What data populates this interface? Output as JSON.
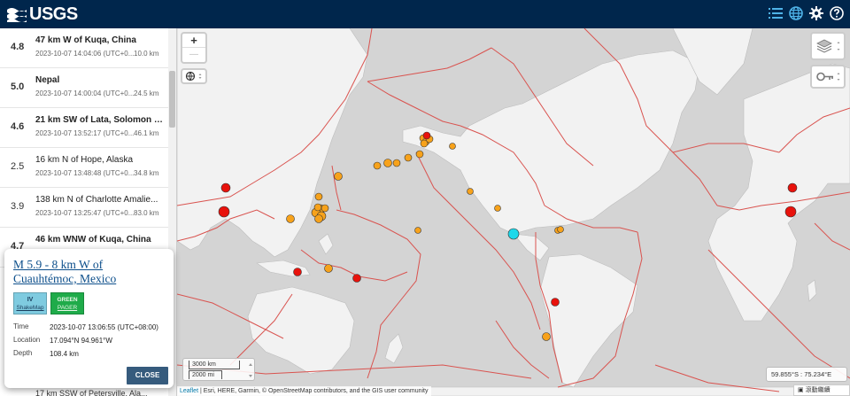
{
  "header": {
    "logo_text": "USGS",
    "icons": [
      "list-icon",
      "globe-icon",
      "gear-icon",
      "help-icon"
    ]
  },
  "list": {
    "items": [
      {
        "mag": "4.8",
        "place": "47 km W of Kuqa, China",
        "time": "2023-10-07 14:04:06 (UTC+0...",
        "depth": "10.0 km",
        "bold": true
      },
      {
        "mag": "5.0",
        "place": "Nepal",
        "time": "2023-10-07 14:00:04 (UTC+0...",
        "depth": "24.5 km",
        "bold": true
      },
      {
        "mag": "4.6",
        "place": "21 km SW of Lata, Solomon I...",
        "time": "2023-10-07 13:52:17 (UTC+0...",
        "depth": "46.1 km",
        "bold": true
      },
      {
        "mag": "2.5",
        "place": "16 km N of Hope, Alaska",
        "time": "2023-10-07 13:48:48 (UTC+0...",
        "depth": "34.8 km",
        "bold": false
      },
      {
        "mag": "3.9",
        "place": "138 km N of Charlotte Amalie...",
        "time": "2023-10-07 13:25:47 (UTC+0...",
        "depth": "83.0 km",
        "bold": false
      },
      {
        "mag": "4.7",
        "place": "46 km WNW of Kuqa, China",
        "time": "",
        "depth": "",
        "bold": true
      }
    ],
    "bottom_partial": "17 km SSW of Petersville, Ala..."
  },
  "map": {
    "zoom_in": "+",
    "zoom_out": "—",
    "scale_km": "3000 km",
    "scale_mi": "2000 mi",
    "coords": "59.855°S : 75.234°E",
    "attribution_link": "Leaflet",
    "attribution_text": " | Esri, HERE, Garmin, © OpenStreetMap contributors, and the GIS user community",
    "lang_label": "滾動繼續"
  },
  "popup": {
    "title": "M 5.9 - 8 km W of Cuauhtémoc, Mexico",
    "shakemap_level": "IV",
    "shakemap_label": "ShakeMap",
    "pager_level": "GREEN",
    "pager_label": "PAGER",
    "time_label": "Time",
    "time_value": "2023-10-07 13:06:55 (UTC+08:00)",
    "location_label": "Location",
    "location_value": "17.094°N 94.961°W",
    "depth_label": "Depth",
    "depth_value": "108.4 km",
    "close_label": "CLOSE"
  },
  "colors": {
    "header_bg": "#00264c",
    "ocean": "#d4d4d4",
    "land": "#f2f2f2",
    "plate_boundary": "#d9534f",
    "eq_orange": "#f7a21b",
    "eq_red": "#e8120c",
    "eq_cyan": "#1dd8ea",
    "shakemap_iv": "#7fcbe0",
    "pager_green": "#1fab4a"
  }
}
